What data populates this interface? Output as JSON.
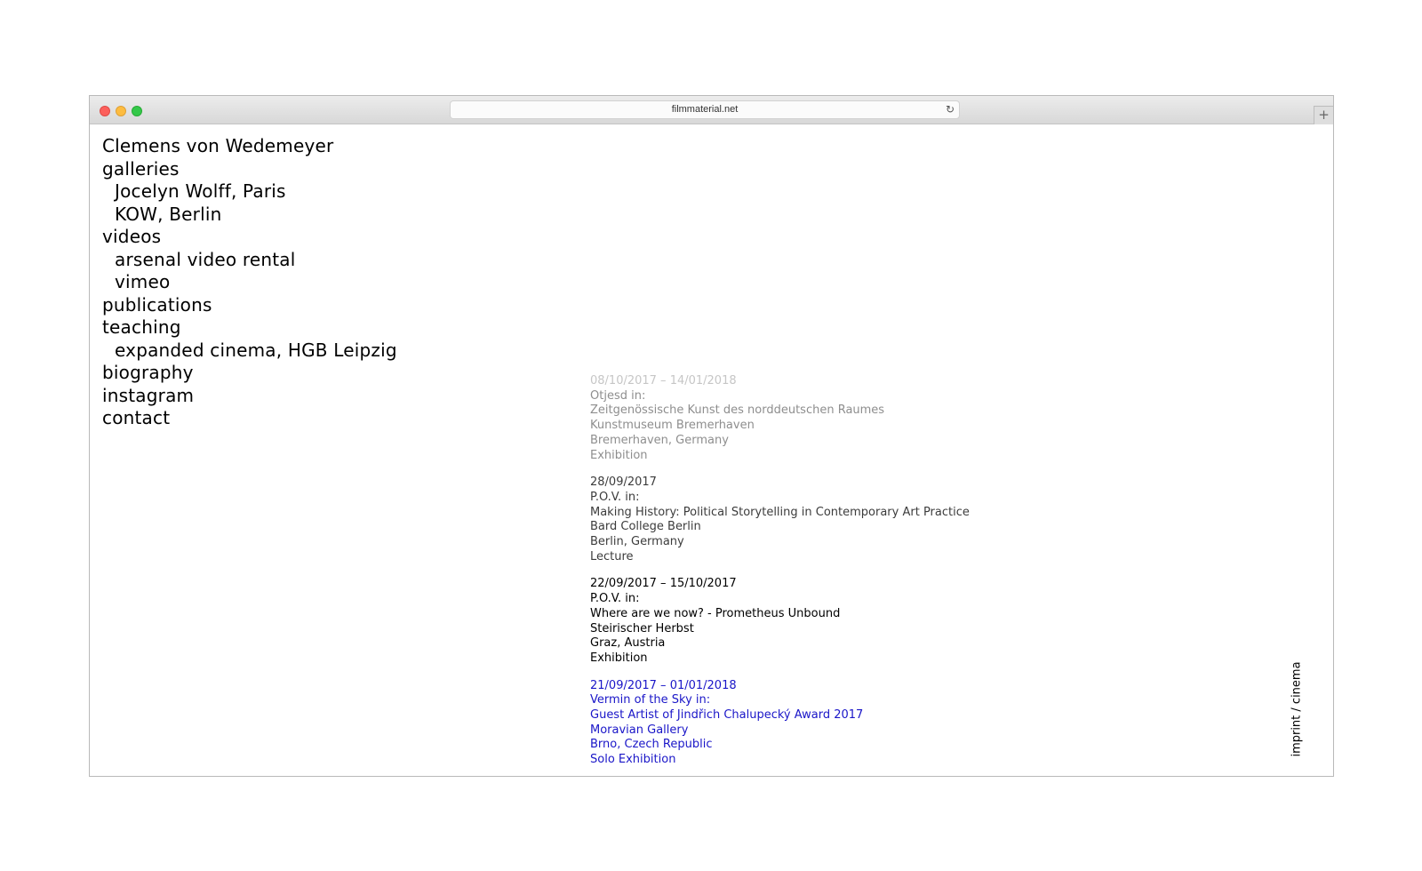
{
  "browser": {
    "url": "filmmaterial.net",
    "reload_icon": "reload-icon",
    "new_tab_label": "+"
  },
  "nav": [
    {
      "label": "Clemens von Wedemeyer",
      "sub": false
    },
    {
      "label": "galleries",
      "sub": false
    },
    {
      "label": "Jocelyn Wolff, Paris",
      "sub": true
    },
    {
      "label": "KOW, Berlin",
      "sub": true
    },
    {
      "label": "videos",
      "sub": false
    },
    {
      "label": "arsenal video rental",
      "sub": true
    },
    {
      "label": "vimeo",
      "sub": true
    },
    {
      "label": "publications",
      "sub": false
    },
    {
      "label": "teaching",
      "sub": false
    },
    {
      "label": "expanded cinema, HGB Leipzig",
      "sub": true
    },
    {
      "label": "biography",
      "sub": false
    },
    {
      "label": "instagram",
      "sub": false
    },
    {
      "label": "contact",
      "sub": false
    }
  ],
  "entries": [
    {
      "color": "#c6c6c6",
      "lines": [
        "08/10/2017 – 14/01/2018"
      ]
    },
    {
      "color": "#8e8e8e",
      "lines": [
        "Otjesd in:",
        "Zeitgenössische Kunst des norddeutschen Raumes",
        "Kunstmuseum Bremerhaven",
        "Bremerhaven, Germany",
        "Exhibition"
      ]
    },
    {
      "color": "#3c3c3c",
      "lines": [
        "28/09/2017",
        "P.O.V. in:",
        "Making History: Political Storytelling in Contemporary Art Practice",
        "Bard College Berlin",
        "Berlin, Germany",
        "Lecture"
      ]
    },
    {
      "color": "#000000",
      "lines": [
        "22/09/2017 – 15/10/2017",
        "P.O.V. in:",
        "Where are we now? - Prometheus Unbound",
        "Steirischer Herbst",
        "Graz, Austria",
        "Exhibition"
      ]
    },
    {
      "color": "#1a16c8",
      "lines": [
        "21/09/2017 – 01/01/2018",
        "Vermin of the Sky in:",
        "Guest Artist of Jindřich Chalupecký Award 2017",
        "Moravian Gallery",
        "Brno, Czech Republic",
        "Solo Exhibition"
      ]
    }
  ],
  "footer_link": "imprint / cinema"
}
